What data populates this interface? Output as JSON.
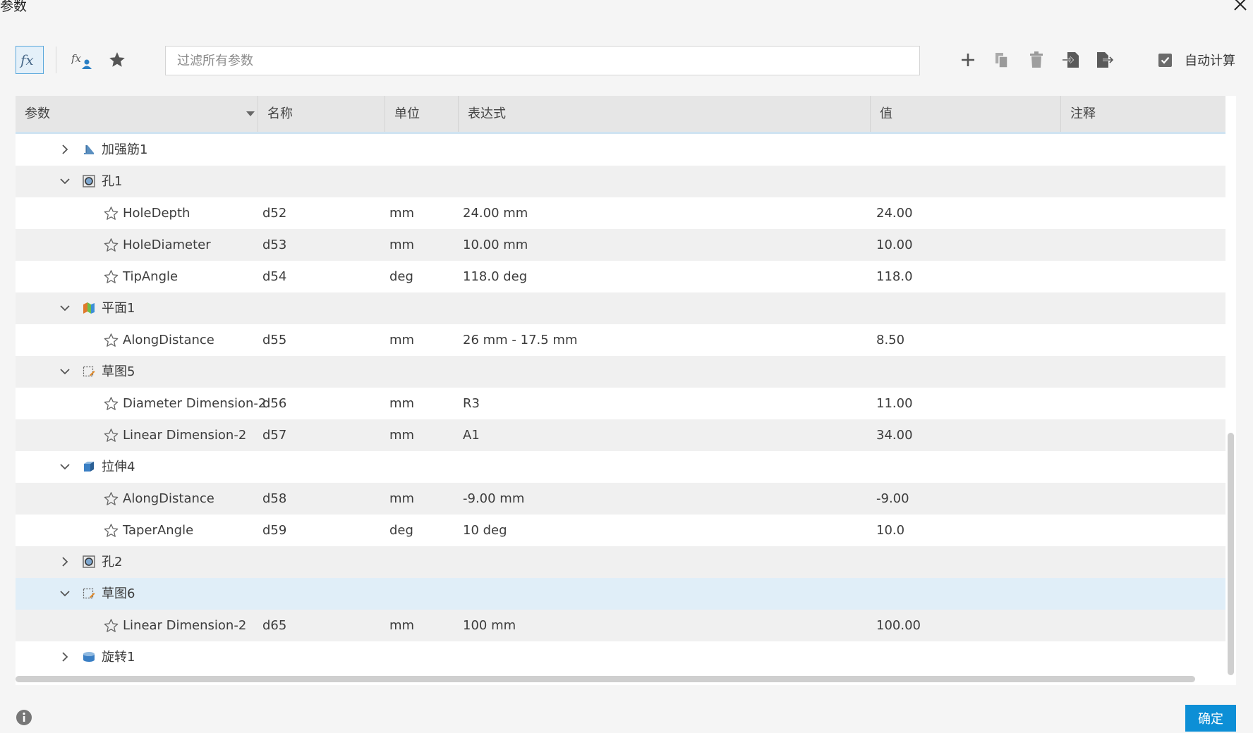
{
  "dialog": {
    "title": "参数",
    "close_icon": "close-icon"
  },
  "toolbar": {
    "icons": [
      "fx-icon",
      "user-fx-icon",
      "star-icon",
      "plus-icon",
      "copy-icon",
      "trash-icon",
      "import-icon",
      "export-icon"
    ],
    "search_placeholder": "过滤所有参数",
    "auto_calc_label": "自动计算",
    "auto_calc_checked": true
  },
  "table": {
    "headers": {
      "param": "参数",
      "name": "名称",
      "unit": "单位",
      "expr": "表达式",
      "value": "值",
      "comment": "注释"
    },
    "groups": [
      {
        "label": "加强筋1",
        "icon": "rib-icon",
        "expanded": false,
        "params": []
      },
      {
        "label": "孔1",
        "icon": "hole-icon",
        "expanded": true,
        "params": [
          {
            "param": "HoleDepth",
            "name": "d52",
            "unit": "mm",
            "expr": "24.00 mm",
            "value": "24.00"
          },
          {
            "param": "HoleDiameter",
            "name": "d53",
            "unit": "mm",
            "expr": "10.00 mm",
            "value": "10.00"
          },
          {
            "param": "TipAngle",
            "name": "d54",
            "unit": "deg",
            "expr": "118.0 deg",
            "value": "118.0"
          }
        ]
      },
      {
        "label": "平面1",
        "icon": "plane-icon",
        "expanded": true,
        "params": [
          {
            "param": "AlongDistance",
            "name": "d55",
            "unit": "mm",
            "expr": "26 mm - 17.5 mm",
            "value": "8.50"
          }
        ]
      },
      {
        "label": "草图5",
        "icon": "sketch-icon",
        "expanded": true,
        "params": [
          {
            "param": "Diameter Dimension-2",
            "name": "d56",
            "unit": "mm",
            "expr": "R3",
            "value": "11.00"
          },
          {
            "param": "Linear Dimension-2",
            "name": "d57",
            "unit": "mm",
            "expr": "A1",
            "value": "34.00"
          }
        ]
      },
      {
        "label": "拉伸4",
        "icon": "extrude-icon",
        "expanded": true,
        "params": [
          {
            "param": "AlongDistance",
            "name": "d58",
            "unit": "mm",
            "expr": "-9.00 mm",
            "value": "-9.00"
          },
          {
            "param": "TaperAngle",
            "name": "d59",
            "unit": "deg",
            "expr": "10 deg",
            "value": "10.0"
          }
        ]
      },
      {
        "label": "孔2",
        "icon": "hole-icon",
        "expanded": false,
        "params": []
      },
      {
        "label": "草图6",
        "icon": "sketch-icon",
        "expanded": true,
        "selected": true,
        "params": [
          {
            "param": "Linear Dimension-2",
            "name": "d65",
            "unit": "mm",
            "expr": "100 mm",
            "value": "100.00"
          }
        ]
      },
      {
        "label": "旋转1",
        "icon": "revolve-icon",
        "expanded": false,
        "params": []
      }
    ]
  },
  "footer": {
    "ok_label": "确定",
    "info_icon": "info-icon"
  },
  "colors": {
    "accent": "#0d8fd6",
    "selected_row": "#e0eef8",
    "header_bg": "#e6e6e6",
    "alt_row": "#f0f0f0"
  }
}
